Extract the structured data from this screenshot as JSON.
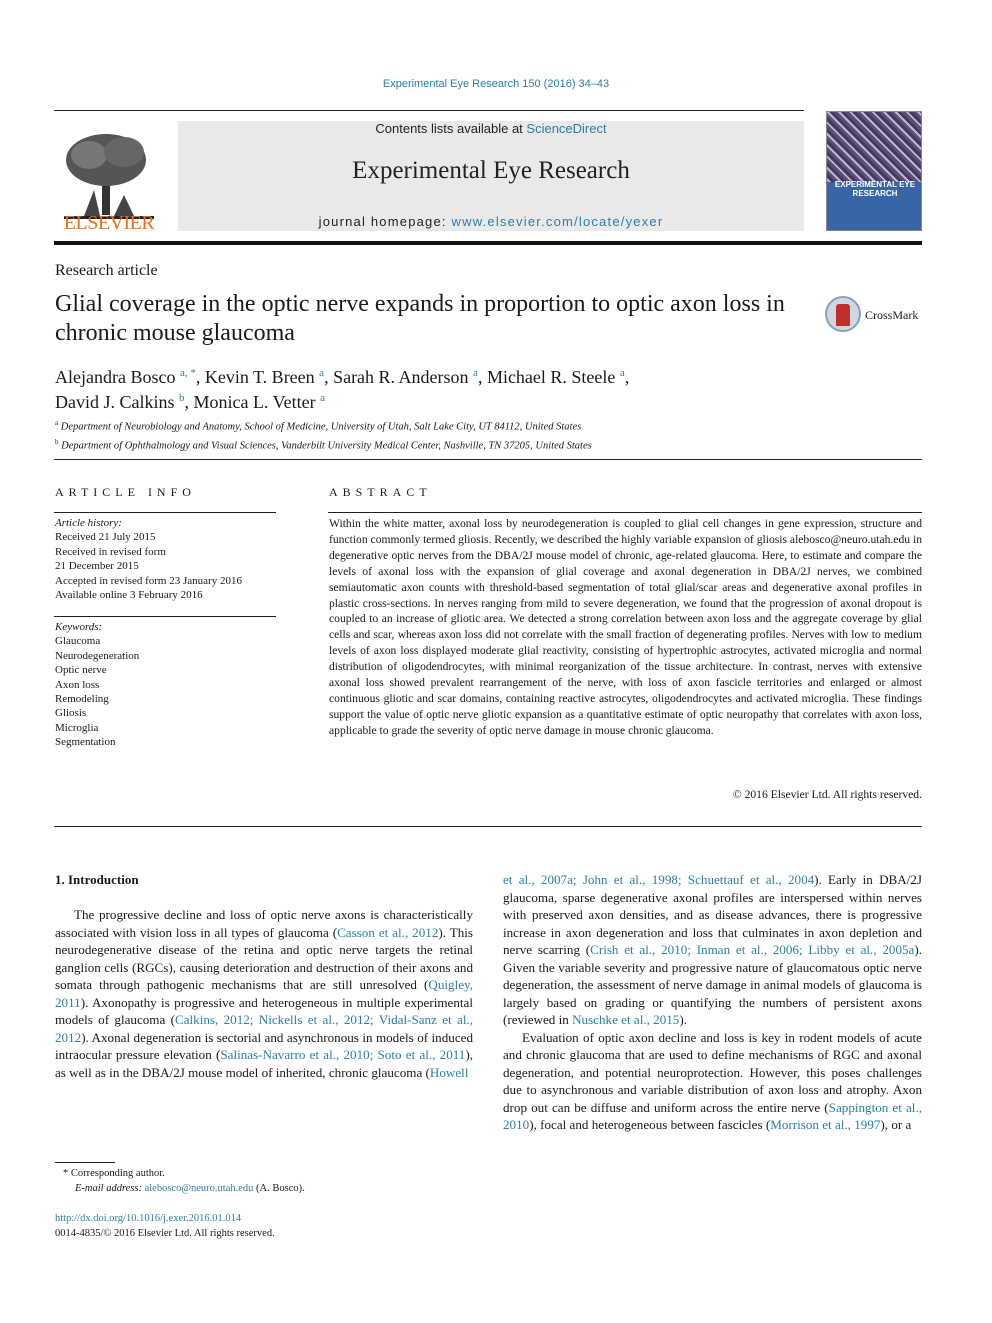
{
  "running_head": "Experimental Eye Research 150 (2016) 34–43",
  "masthead": {
    "publisher": "ELSEVIER",
    "contents_prefix": "Contents lists available at ",
    "contents_link": "ScienceDirect",
    "journal_name": "Experimental Eye Research",
    "homepage_prefix": "journal homepage: ",
    "homepage_link": "www.elsevier.com/locate/yexer",
    "cover_title": "EXPERIMENTAL EYE RESEARCH"
  },
  "article": {
    "type": "Research article",
    "title": "Glial coverage in the optic nerve expands in proportion to optic axon loss in chronic mouse glaucoma",
    "crossmark_label": "CrossMark",
    "authors": [
      {
        "name": "Alejandra Bosco",
        "sup": "a, *",
        "sep": ", "
      },
      {
        "name": "Kevin T. Breen",
        "sup": "a",
        "sep": ", "
      },
      {
        "name": "Sarah R. Anderson",
        "sup": "a",
        "sep": ", "
      },
      {
        "name": "Michael R. Steele",
        "sup": "a",
        "sep": ","
      },
      {
        "name": "David J. Calkins",
        "sup": "b",
        "sep": ", "
      },
      {
        "name": "Monica L. Vetter",
        "sup": "a",
        "sep": ""
      }
    ],
    "affiliations": [
      {
        "sup": "a",
        "text": "Department of Neurobiology and Anatomy, School of Medicine, University of Utah, Salt Lake City, UT 84112, United States"
      },
      {
        "sup": "b",
        "text": "Department of Ophthalmology and Visual Sciences, Vanderbilt University Medical Center, Nashville, TN 37205, United States"
      }
    ]
  },
  "article_info": {
    "heading": "ARTICLE INFO",
    "history_label": "Article history:",
    "history": [
      "Received 21 July 2015",
      "Received in revised form",
      "21 December 2015",
      "Accepted in revised form 23 January 2016",
      "Available online 3 February 2016"
    ],
    "keywords_label": "Keywords:",
    "keywords": [
      "Glaucoma",
      "Neurodegeneration",
      "Optic nerve",
      "Axon loss",
      "Remodeling",
      "Gliosis",
      "Microglia",
      "Segmentation"
    ]
  },
  "abstract": {
    "heading": "ABSTRACT",
    "text": "Within the white matter, axonal loss by neurodegeneration is coupled to glial cell changes in gene expression, structure and function commonly termed gliosis. Recently, we described the highly variable expansion of gliosis alebosco@neuro.utah.edu in degenerative optic nerves from the DBA/2J mouse model of chronic, age-related glaucoma. Here, to estimate and compare the levels of axonal loss with the expansion of glial coverage and axonal degeneration in DBA/2J nerves, we combined semiautomatic axon counts with threshold-based segmentation of total glial/scar areas and degenerative axonal profiles in plastic cross-sections. In nerves ranging from mild to severe degeneration, we found that the progression of axonal dropout is coupled to an increase of gliotic area. We detected a strong correlation between axon loss and the aggregate coverage by glial cells and scar, whereas axon loss did not correlate with the small fraction of degenerating profiles. Nerves with low to medium levels of axon loss displayed moderate glial reactivity, consisting of hypertrophic astrocytes, activated microglia and normal distribution of oligo­dendrocytes, with minimal reorganization of the tissue architecture. In contrast, nerves with extensive axonal loss showed prevalent rearrangement of the nerve, with loss of axon fascicle territories and enlarged or almost continuous gliotic and scar domains, containing reactive astrocytes, oligodendrocytes and activated microglia. These findings support the value of optic nerve gliotic expansion as a quanti­tative estimate of optic neuropathy that correlates with axon loss, applicable to grade the severity of optic nerve damage in mouse chronic glaucoma.",
    "copyright": "© 2016 Elsevier Ltd. All rights reserved."
  },
  "body": {
    "section_heading": "1.  Introduction",
    "left_column": [
      {
        "t": "The progressive decline and loss of optic nerve axons is char­acteristically associated with vision loss in all types of glaucoma ("
      },
      {
        "t": "Casson et al., 2012",
        "link": true
      },
      {
        "t": "). This neurodegenerative disease of the retina and optic nerve targets the retinal ganglion cells (RGCs), causing deterioration and destruction of their axons and somata through pathogenic mechanisms that are still unresolved ("
      },
      {
        "t": "Quigley, 2011",
        "link": true
      },
      {
        "t": "). Axonopathy is progressive and heterogeneous in multiple exper­imental models of glaucoma ("
      },
      {
        "t": "Calkins, 2012; Nickells et al., 2012; Vidal-Sanz et al., 2012",
        "link": true
      },
      {
        "t": "). Axonal degeneration is sectorial and asynchronous in models of induced intraocular pressure elevation ("
      },
      {
        "t": "Salinas-Navarro et al., 2010; Soto et al., 2011",
        "link": true
      },
      {
        "t": "), as well as in the DBA/2J mouse model of inherited, chronic glaucoma ("
      },
      {
        "t": "Howell",
        "link": true
      }
    ],
    "right_column_p1": [
      {
        "t": "et al., 2007a; John et al., 1998; Schuettauf et al., 2004",
        "link": true
      },
      {
        "t": "). Early in DBA/2J glaucoma, sparse degenerative axonal profiles are inter­spersed within nerves with preserved axon densities, and as disease advances, there is progressive increase in axon degener­ation and loss that culminates in axon depletion and nerve scar­ring ("
      },
      {
        "t": "Crish et al., 2010; Inman et al., 2006; Libby et al., 2005a",
        "link": true
      },
      {
        "t": "). Given the variable severity and progressive nature of glaucoma­tous optic nerve degeneration, the assessment of nerve damage in animal models of glaucoma is largely based on grading or quan­tifying the numbers of persistent axons (reviewed in "
      },
      {
        "t": "Nuschke et al., 2015",
        "link": true
      },
      {
        "t": ")."
      }
    ],
    "right_column_p2": [
      {
        "t": "Evaluation of optic axon decline and loss is key in rodent models of acute and chronic glaucoma that are used to define mechanisms of RGC and axonal degeneration, and potential neuroprotection. However, this poses challenges due to asynchronous and variable distribution of axon loss and atrophy. Axon drop out can be diffuse and uniform across the entire nerve ("
      },
      {
        "t": "Sappington et al., 2010",
        "link": true
      },
      {
        "t": "), focal and heterogeneous between fascicles ("
      },
      {
        "t": "Morrison et al., 1997",
        "link": true
      },
      {
        "t": "), or a"
      }
    ]
  },
  "footnote": {
    "star_label": "* Corresponding author.",
    "email_label": "E-mail address: ",
    "email": "alebosco@neuro.utah.edu",
    "email_suffix": " (A. Bosco)."
  },
  "doi": {
    "link": "http://dx.doi.org/10.1016/j.exer.2016.01.014",
    "issn_line": "0014-4835/© 2016 Elsevier Ltd. All rights reserved."
  }
}
